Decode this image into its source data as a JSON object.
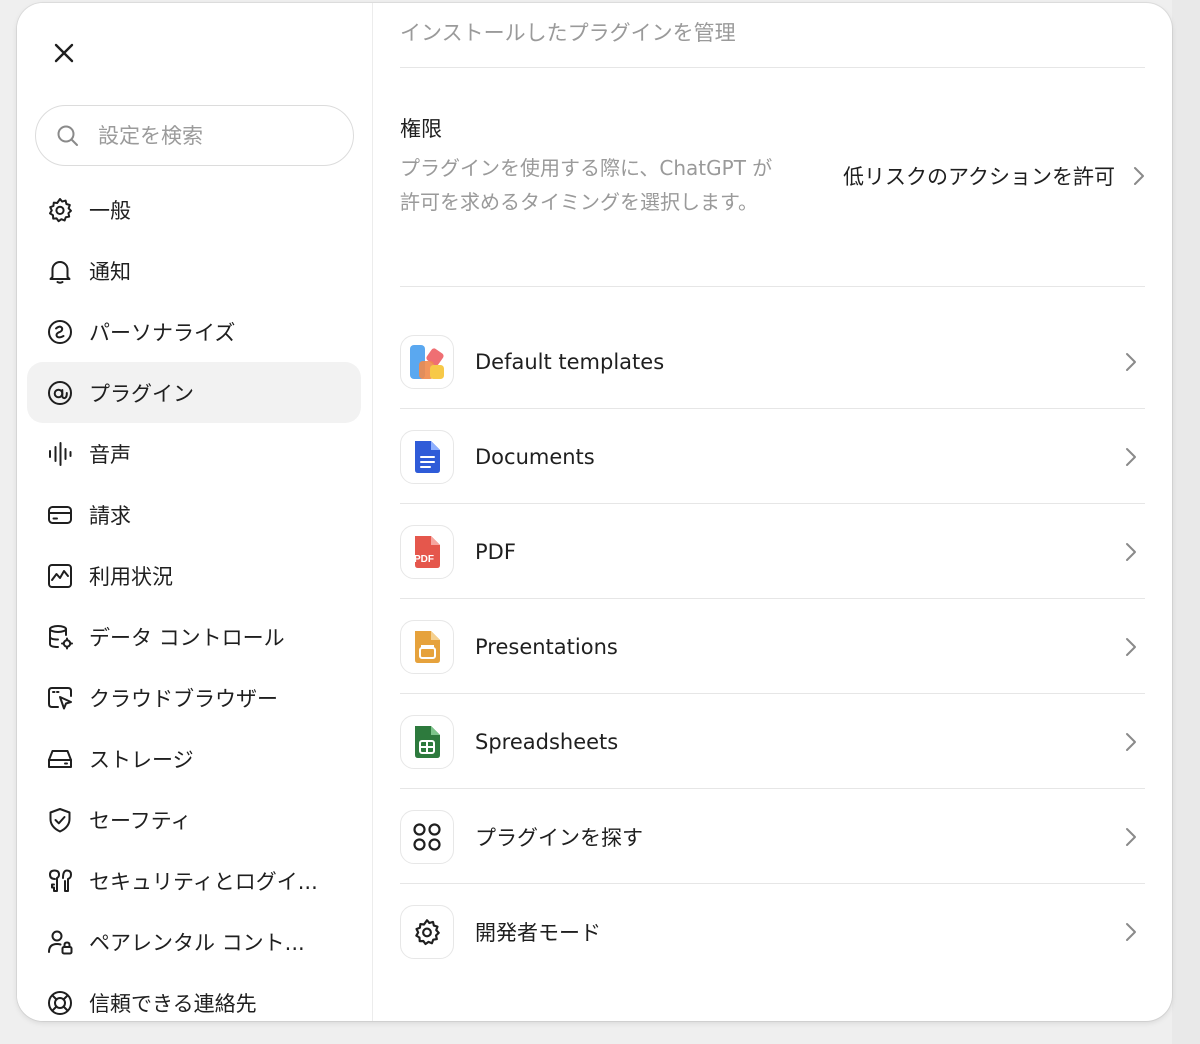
{
  "sidebar": {
    "search_placeholder": "設定を検索",
    "items": [
      {
        "label": "一般",
        "icon": "gear-icon"
      },
      {
        "label": "通知",
        "icon": "bell-icon"
      },
      {
        "label": "パーソナライズ",
        "icon": "personalize-icon"
      },
      {
        "label": "プラグイン",
        "icon": "plugin-icon",
        "active": true
      },
      {
        "label": "音声",
        "icon": "audio-wave-icon"
      },
      {
        "label": "請求",
        "icon": "credit-card-icon"
      },
      {
        "label": "利用状況",
        "icon": "usage-chart-icon"
      },
      {
        "label": "データ コントロール",
        "icon": "database-gear-icon"
      },
      {
        "label": "クラウドブラウザー",
        "icon": "cloud-browser-icon"
      },
      {
        "label": "ストレージ",
        "icon": "storage-drive-icon"
      },
      {
        "label": "セーフティ",
        "icon": "shield-check-icon"
      },
      {
        "label": "セキュリティとログイ...",
        "icon": "security-key-icon"
      },
      {
        "label": "ペアレンタル コント...",
        "icon": "parental-user-lock-icon"
      },
      {
        "label": "信頼できる連絡先",
        "icon": "lifebuoy-icon"
      }
    ]
  },
  "main": {
    "subtitle": "インストールしたプラグインを管理",
    "permissions": {
      "title": "権限",
      "description": "プラグインを使用する際に、ChatGPT が許可を求めるタイミングを選択します。",
      "value": "低リスクのアクションを許可"
    },
    "plugins": [
      {
        "name": "Default templates",
        "icon": "default-templates-icon"
      },
      {
        "name": "Documents",
        "icon": "documents-icon"
      },
      {
        "name": "PDF",
        "icon": "pdf-icon",
        "badge": "PDF"
      },
      {
        "name": "Presentations",
        "icon": "presentations-icon"
      },
      {
        "name": "Spreadsheets",
        "icon": "spreadsheets-icon"
      },
      {
        "name": "プラグインを探す",
        "icon": "discover-plugins-icon"
      },
      {
        "name": "開発者モード",
        "icon": "developer-gear-icon"
      }
    ]
  },
  "colors": {
    "documents_blue": "#2f5bd8",
    "pdf_red": "#e5574c",
    "presentations_orange": "#e6a23c",
    "spreadsheets_green": "#2d7a3d",
    "active_nav_bg": "#f2f2f2"
  }
}
